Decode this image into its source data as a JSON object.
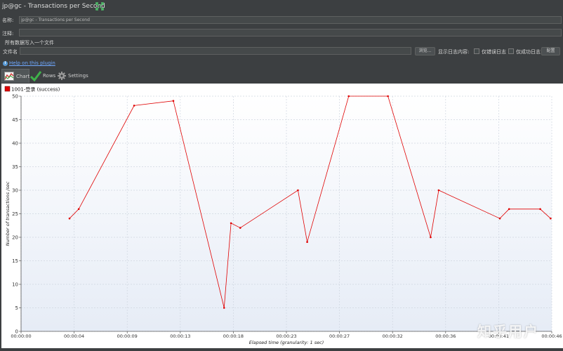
{
  "window": {
    "title": "jp@gc - Transactions per Second"
  },
  "form": {
    "name_label": "名称:",
    "name_value": "jp@gc - Transactions per Second",
    "comment_label": "注释:",
    "comment_value": "",
    "write_all_label": "所有数据写入一个文件",
    "filename_label": "文件名",
    "filename_value": "",
    "browse_label": "浏览...",
    "log_content_label": "显示日志内容:",
    "errors_only_label": "仅错误日志",
    "success_only_label": "仅成功日志",
    "configure_label": "配置"
  },
  "help": {
    "link_text": "Help on this plugin"
  },
  "tabs": [
    {
      "label": "Chart",
      "icon": "chart-icon",
      "active": true
    },
    {
      "label": "Rows",
      "icon": "checkmark-icon",
      "active": false
    },
    {
      "label": "Settings",
      "icon": "gear-icon",
      "active": false
    }
  ],
  "watermark": "知乎用户",
  "chart_data": {
    "type": "line",
    "series": [
      {
        "name": "1001-登录 (success)",
        "color": "#e00000",
        "x": [
          "00:00:04.2",
          "00:00:05",
          "00:00:09.8",
          "00:00:13.2",
          "00:00:17.6",
          "00:00:18.2",
          "00:00:19",
          "00:00:24",
          "00:00:24.8",
          "00:00:28.4",
          "00:00:31.8",
          "00:00:35.5",
          "00:00:36.2",
          "00:00:41.5",
          "00:00:42.3",
          "00:00:45",
          "00:00:45.9"
        ],
        "x_seconds": [
          4.2,
          5.0,
          9.8,
          13.2,
          17.6,
          18.2,
          19.0,
          24.0,
          24.8,
          28.4,
          31.8,
          35.5,
          36.2,
          41.5,
          42.3,
          45.0,
          45.9
        ],
        "y": [
          24,
          26,
          48,
          49,
          5,
          23,
          22,
          30,
          19,
          50,
          50,
          20,
          30,
          24,
          26,
          26,
          24
        ]
      }
    ],
    "xlabel": "Elapsed time (granularity: 1 sec)",
    "ylabel": "Number of transactions /sec",
    "x_ticks": [
      "00:00:00",
      "00:00:04",
      "00:00:09",
      "00:00:13",
      "00:00:18",
      "00:00:23",
      "00:00:27",
      "00:00:32",
      "00:00:36",
      "00:00:41",
      "00:00:46"
    ],
    "x_tick_seconds": [
      0,
      4.6,
      9.2,
      13.8,
      18.4,
      23,
      27.6,
      32.2,
      36.8,
      41.4,
      46
    ],
    "y_ticks": [
      0,
      5,
      10,
      15,
      20,
      25,
      30,
      35,
      40,
      45,
      50
    ],
    "xlim": [
      0,
      46
    ],
    "ylim": [
      0,
      50
    ],
    "grid": true,
    "legend": "top-left"
  }
}
